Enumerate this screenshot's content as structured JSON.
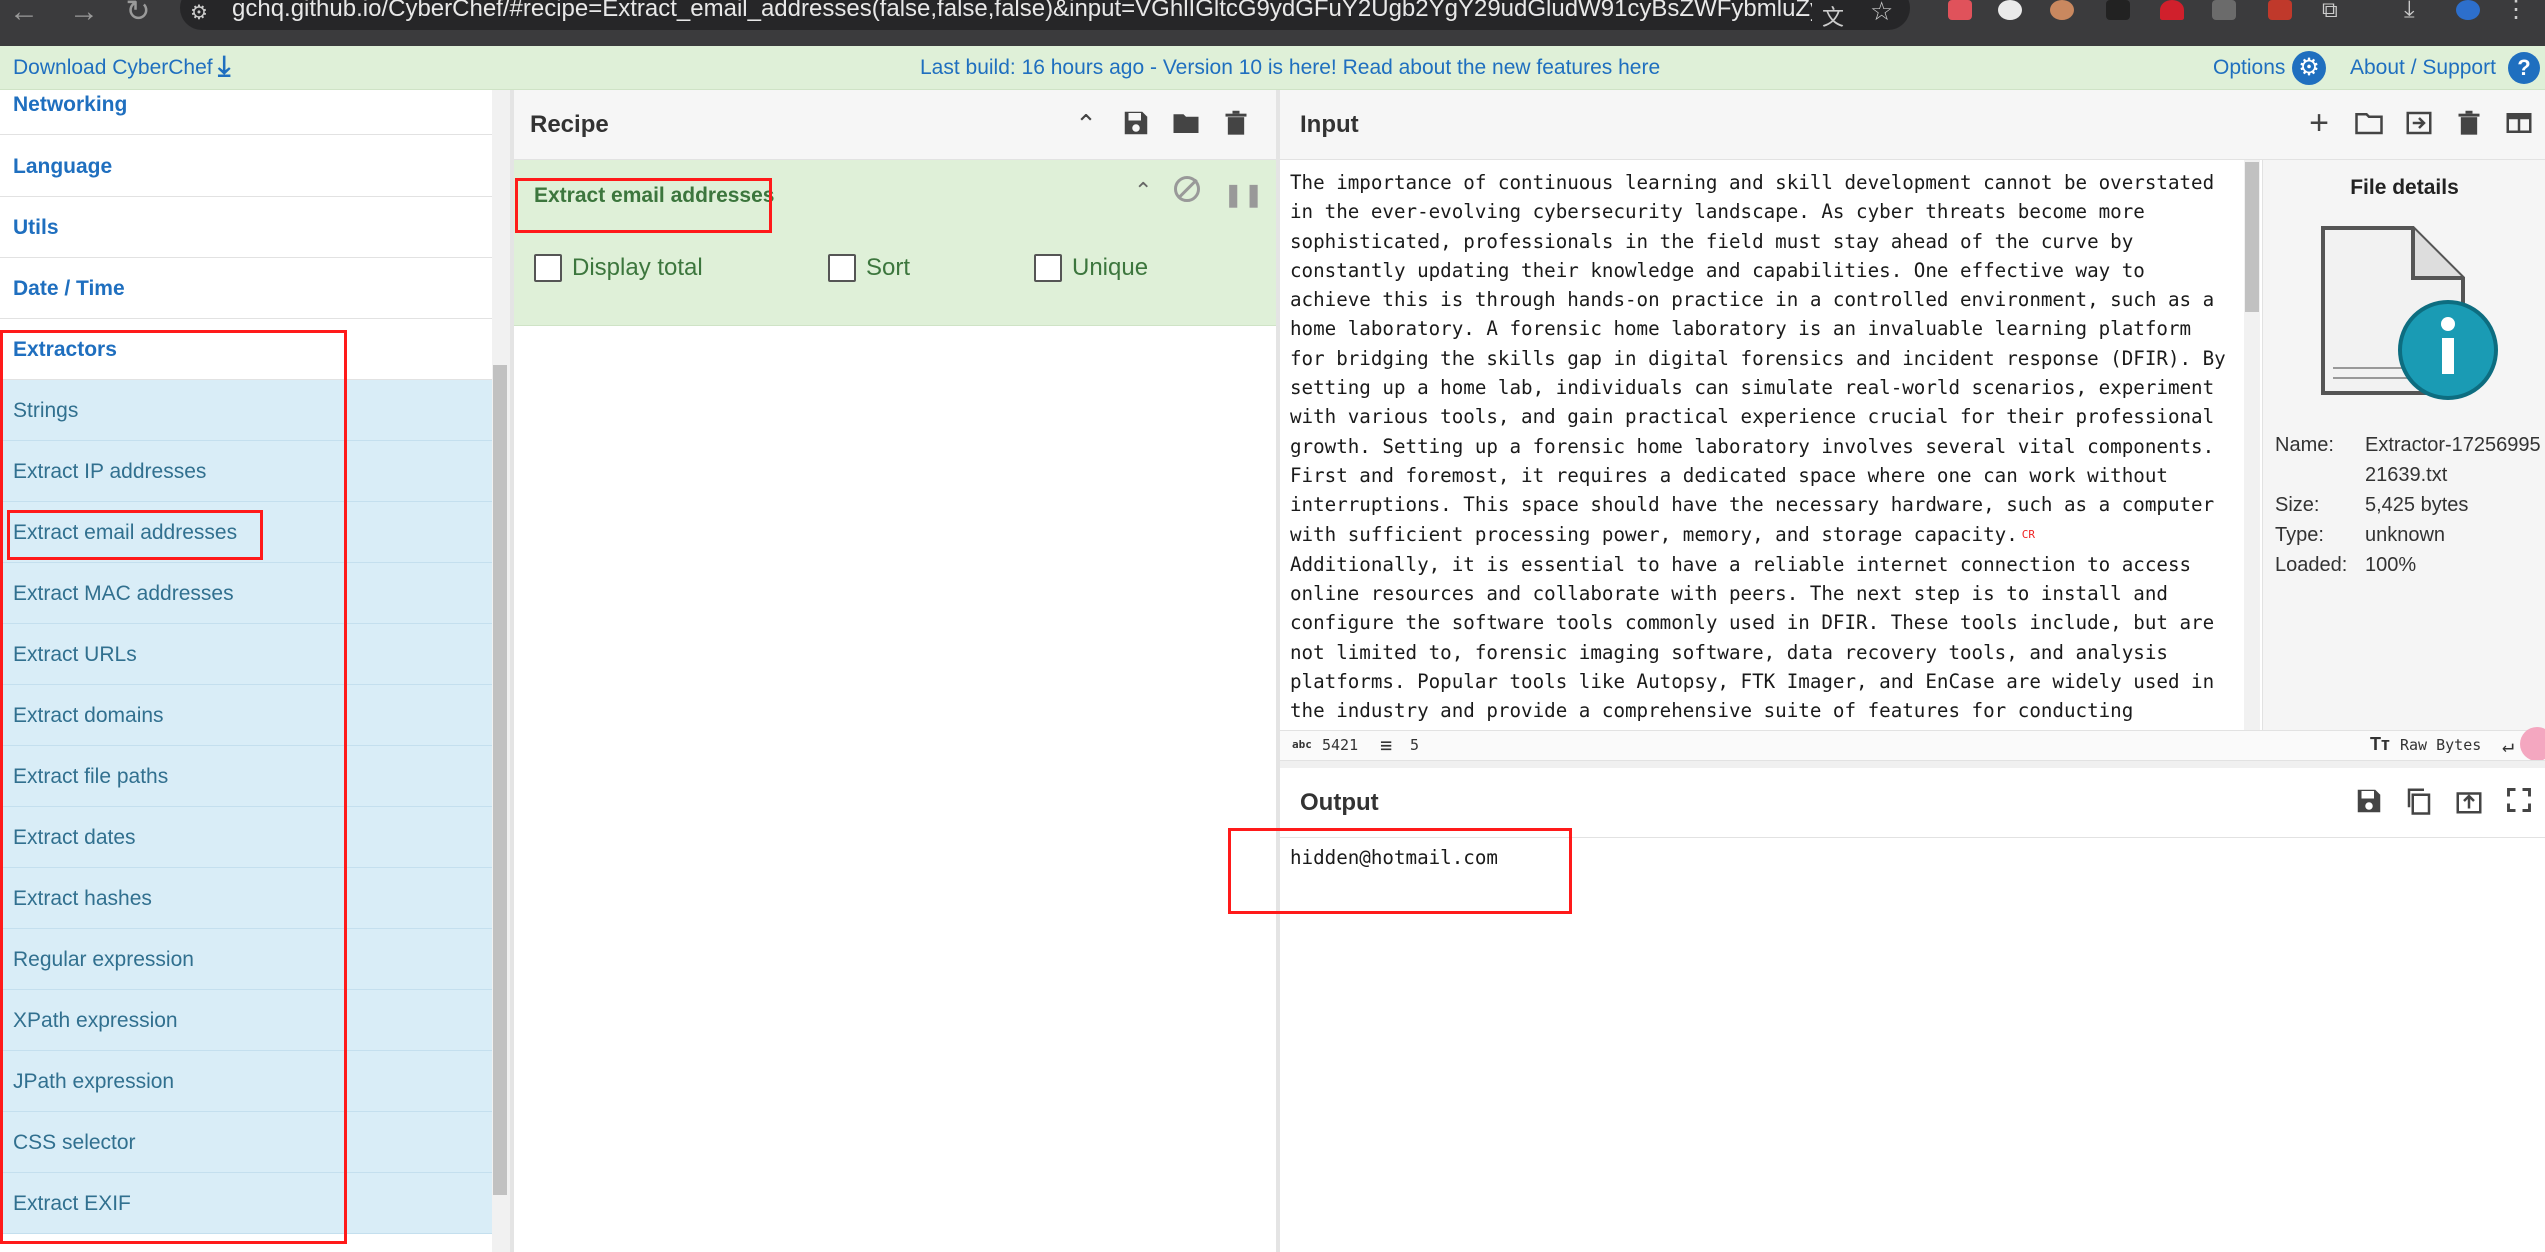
{
  "browser": {
    "url": "gchq.github.io/CyberChef/#recipe=Extract_email_addresses(false,false,false)&input=VGhlIGltcG9ydGFuY2Ugb2YgY29udGludW91cyBsZWFybmluZyBhbmQ..."
  },
  "banner": {
    "download": "Download CyberChef",
    "build": "Last build: 16 hours ago - Version 10 is here! Read about the new features here",
    "options": "Options",
    "about": "About / Support"
  },
  "operations": {
    "categories": [
      "Networking",
      "Language",
      "Utils",
      "Date / Time",
      "Extractors"
    ],
    "items": [
      "Strings",
      "Extract IP addresses",
      "Extract email addresses",
      "Extract MAC addresses",
      "Extract URLs",
      "Extract domains",
      "Extract file paths",
      "Extract dates",
      "Extract hashes",
      "Regular expression",
      "XPath expression",
      "JPath expression",
      "CSS selector",
      "Extract EXIF"
    ]
  },
  "recipe": {
    "title": "Recipe",
    "operation": {
      "name": "Extract email addresses",
      "options": [
        "Display total",
        "Sort",
        "Unique"
      ]
    }
  },
  "input": {
    "title": "Input",
    "lines": [
      "The importance of continuous learning and skill development cannot be overstated",
      "in the ever-evolving cybersecurity landscape. As cyber threats become more",
      "sophisticated, professionals in the field must stay ahead of the curve by",
      "constantly updating their knowledge and capabilities. One effective way to",
      "achieve this is through hands-on practice in a controlled environment, such as a",
      "home laboratory. A forensic home laboratory is an invaluable learning platform",
      "for bridging the skills gap in digital forensics and incident response (DFIR). By",
      "setting up a home lab, individuals can simulate real-world scenarios, experiment",
      "with various tools, and gain practical experience crucial for their professional",
      "growth. Setting up a forensic home laboratory involves several vital components.",
      "First and foremost, it requires a dedicated space where one can work without",
      "interruptions. This space should have the necessary hardware, such as a computer",
      "with sufficient processing power, memory, and storage capacity.",
      "Additionally, it is essential to have a reliable internet connection to access",
      "online resources and collaborate with peers. The next step is to install and",
      "configure the software tools commonly used in DFIR. These tools include, but are",
      "not limited to, forensic imaging software, data recovery tools, and analysis",
      "platforms. Popular tools like Autopsy, FTK Imager, and EnCase are widely used in",
      "the industry and provide a comprehensive suite of features for conducting"
    ],
    "cr_marker": "CR",
    "status": {
      "length_label": "abc",
      "length": "5421",
      "lines": "5",
      "encoding": "Raw Bytes"
    }
  },
  "file_details": {
    "title": "File details",
    "rows": [
      {
        "label": "Name:",
        "value": "Extractor-1725699521639.txt"
      },
      {
        "label": "Size:",
        "value": "5,425 bytes"
      },
      {
        "label": "Type:",
        "value": "unknown"
      },
      {
        "label": "Loaded:",
        "value": "100%"
      }
    ]
  },
  "output": {
    "title": "Output",
    "text": "hidden@hotmail.com"
  },
  "colors": {
    "banner_bg": "#dff0d8",
    "link": "#1f6fbf",
    "op_bg": "#d9edf7",
    "recipe_green": "#3c763d",
    "highlight": "#ff1a1a"
  }
}
